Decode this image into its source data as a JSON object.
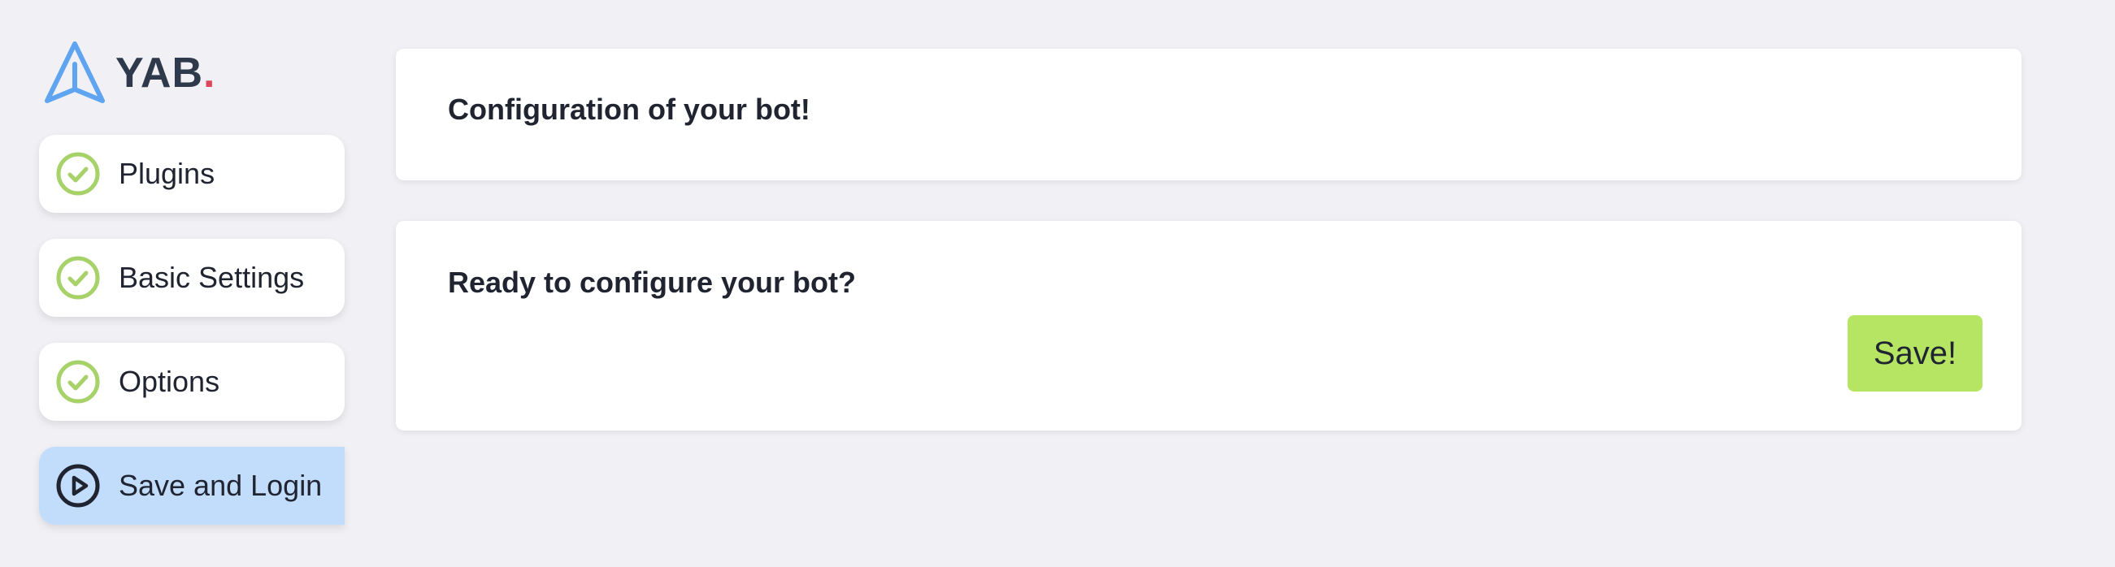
{
  "brand": {
    "name": "YAB",
    "dot": ".",
    "icon": "navigation-arrow-icon",
    "accent_color": "#e0465a",
    "logo_color": "#5ea4f0"
  },
  "sidebar": {
    "items": [
      {
        "label": "Plugins",
        "icon": "check-circle-icon",
        "status": "complete"
      },
      {
        "label": "Basic Settings",
        "icon": "check-circle-icon",
        "status": "complete"
      },
      {
        "label": "Options",
        "icon": "check-circle-icon",
        "status": "complete"
      },
      {
        "label": "Save and Login",
        "icon": "play-circle-icon",
        "status": "current"
      }
    ],
    "complete_color": "#a7d26a",
    "active_bg": "#c2dcfb"
  },
  "main": {
    "header_title": "Configuration of your bot!",
    "save_section": {
      "title": "Ready to configure your bot?",
      "save_label": "Save!",
      "save_color": "#b6e564"
    }
  }
}
